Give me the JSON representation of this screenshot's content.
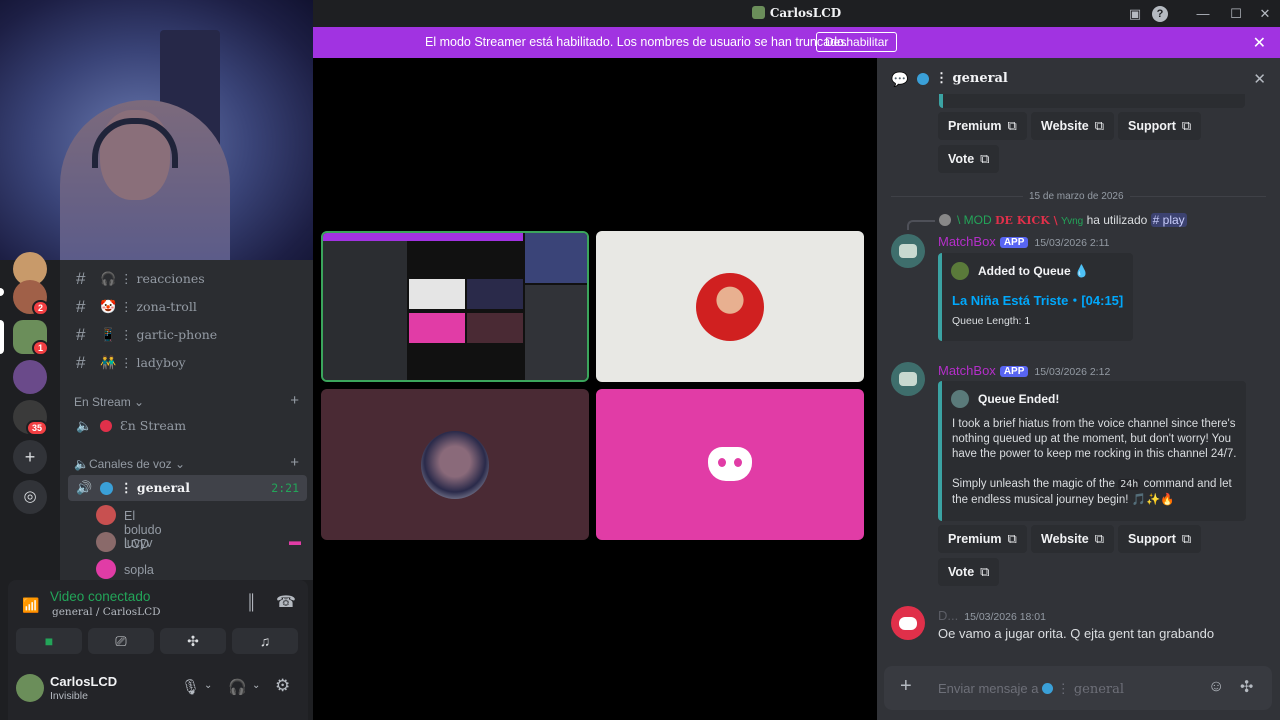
{
  "window": {
    "title": "CarlosLCD"
  },
  "banner": {
    "message": "El modo Streamer está habilitado. Los nombres de usuario se han truncado.",
    "disable_label": "Deshabilitar"
  },
  "servers": {
    "badges": [
      "2",
      "1",
      "35"
    ]
  },
  "channels": {
    "text": [
      {
        "icon": "headphones-icon",
        "name": "⋮ reacciones"
      },
      {
        "icon": "emoji-icon",
        "name": "⋮ zona-troll"
      },
      {
        "icon": "phone-icon",
        "name": "⋮ gartic-phone"
      },
      {
        "icon": "people-icon",
        "name": "⋮ ladyboy"
      }
    ],
    "stream_category": "En Stream",
    "stream_channel": "Ɛn Stream",
    "voice_category": "Canales de voz",
    "voice_channel": {
      "name": "⋮ general",
      "timer": "2:21"
    },
    "voice_users": [
      "El boludo LCD",
      "luvyv",
      "sopla anos a domicilios"
    ]
  },
  "voice_panel": {
    "status": "Video conectado",
    "location": "general / CarlosLCD"
  },
  "user": {
    "name": "CarlosLCD",
    "status": "Invisible"
  },
  "chat": {
    "channel": "general",
    "date_divider": "15 de marzo de 2026",
    "links": [
      "Premium",
      "Website",
      "Support",
      "Vote"
    ],
    "reply": {
      "name": "\\ MOD",
      "tag": "DE KICK \\",
      "extra": "Yvng",
      "action": "ha utilizado",
      "command": "play"
    },
    "msg1": {
      "author": "MatchBox",
      "app": "APP",
      "time": "15/03/2026 2:11",
      "embed_title": "Added to Queue",
      "song": "La Niña Está Triste・[04:15]",
      "queue": "Queue Length: 1"
    },
    "msg2": {
      "author": "MatchBox",
      "app": "APP",
      "time": "15/03/2026 2:12",
      "embed_title": "Queue Ended!",
      "p1": "I took a brief hiatus from the voice channel since there's nothing queued up at the moment, but don't worry! You have the power to keep me rocking in this channel 24/7.",
      "p2a": "Simply unleash the magic of the",
      "p2code": "24h",
      "p2b": "command and let the endless musical journey begin! 🎵✨🔥"
    },
    "msg3": {
      "author": "D...",
      "time": "15/03/2026 18:01",
      "text": "Oe vamo a jugar orita. Q ejta gent tan grabando"
    },
    "composer_placeholder": "Enviar mensaje a",
    "composer_channel": "⋮ general"
  },
  "colors": {
    "banner": "#a133e1",
    "discord_pink": "#e13ca6",
    "green": "#23a559"
  }
}
